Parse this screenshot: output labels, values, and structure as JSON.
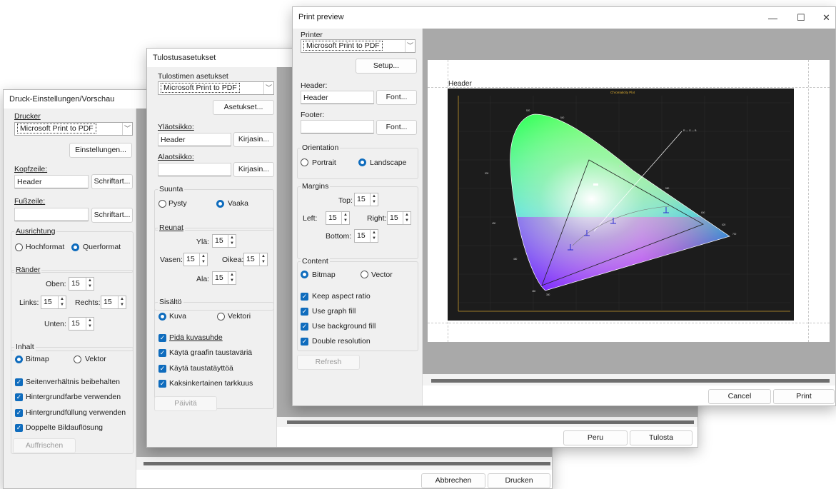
{
  "german": {
    "title": "Druck-Einstellungen/Vorschau",
    "printer_label": "Drucker",
    "printer_value": "Microsoft Print to PDF",
    "settings_button": "Einstellungen...",
    "header_label": "Kopfzeile:",
    "header_value": "Header",
    "header_font_button": "Schriftart...",
    "footer_label": "Fußzeile:",
    "footer_value": "",
    "footer_font_button": "Schriftart...",
    "orientation_label": "Ausrichtung",
    "portrait_label": "Hochformat",
    "landscape_label": "Querformat",
    "margins_label": "Ränder",
    "top_label": "Oben:",
    "left_label": "Links:",
    "right_label": "Rechts:",
    "bottom_label": "Unten:",
    "top_value": "15",
    "left_value": "15",
    "right_value": "15",
    "bottom_value": "15",
    "content_label": "Inhalt",
    "bitmap_label": "Bitmap",
    "vector_label": "Vektor",
    "check1": "Seitenverhältnis beibehalten",
    "check2": "Hintergrundfarbe verwenden",
    "check3": "Hintergrundfüllung verwenden",
    "check4": "Doppelte Bildauflösung",
    "refresh_button": "Auffrischen",
    "cancel_button": "Abbrechen",
    "print_button": "Drucken"
  },
  "finnish": {
    "title": "Tulostusasetukset",
    "printer_label": "Tulostimen asetukset",
    "printer_value": "Microsoft Print to PDF",
    "settings_button": "Asetukset...",
    "header_label": "Yläotsikko:",
    "header_value": "Header",
    "header_font_button": "Kirjasin...",
    "footer_label": "Alaotsikko:",
    "footer_value": "",
    "footer_font_button": "Kirjasin...",
    "orientation_label": "Suunta",
    "portrait_label": "Pysty",
    "landscape_label": "Vaaka",
    "margins_label": "Reunat",
    "top_label": "Ylä:",
    "left_label": "Vasen:",
    "right_label": "Oikea:",
    "bottom_label": "Ala:",
    "top_value": "15",
    "left_value": "15",
    "right_value": "15",
    "bottom_value": "15",
    "content_label": "Sisältö",
    "bitmap_label": "Kuva",
    "vector_label": "Vektori",
    "check1": "Pidä kuvasuhde",
    "check2": "Käytä graafin taustaväriä",
    "check3": "Käytä taustatäyttöä",
    "check4": "Kaksinkertainen tarkkuus",
    "refresh_button": "Päivitä",
    "cancel_button": "Peru",
    "print_button": "Tulosta"
  },
  "english": {
    "title": "Print preview",
    "printer_label": "Printer",
    "printer_value": "Microsoft Print to PDF",
    "settings_button": "Setup...",
    "header_label": "Header:",
    "header_value": "Header",
    "header_font_button": "Font...",
    "footer_label": "Footer:",
    "footer_value": "",
    "footer_font_button": "Font...",
    "orientation_label": "Orientation",
    "portrait_label": "Portrait",
    "landscape_label": "Landscape",
    "margins_label": "Margins",
    "top_label": "Top:",
    "left_label": "Left:",
    "right_label": "Right:",
    "bottom_label": "Bottom:",
    "top_value": "15",
    "left_value": "15",
    "right_value": "15",
    "bottom_value": "15",
    "content_label": "Content",
    "bitmap_label": "Bitmap",
    "vector_label": "Vector",
    "check1": "Keep aspect ratio",
    "check2": "Use graph fill",
    "check3": "Use background fill",
    "check4": "Double resolution",
    "refresh_button": "Refresh",
    "cancel_button": "Cancel",
    "print_button": "Print",
    "window_controls": {
      "minimize": "—",
      "maximize": "☐",
      "close": "✕"
    }
  },
  "preview": {
    "page_header": "Header",
    "chart_title": "Chromaticity Plot",
    "wavelength_labels": [
      "520",
      "540",
      "560",
      "580",
      "600",
      "620",
      "700",
      "500",
      "490",
      "480",
      "460",
      "380"
    ]
  },
  "colors": {
    "accent": "#0f6cbd",
    "window_bg": "#f0f0f0",
    "preview_bg": "#a9a9a9",
    "chart_bg": "#1c1c1c"
  }
}
